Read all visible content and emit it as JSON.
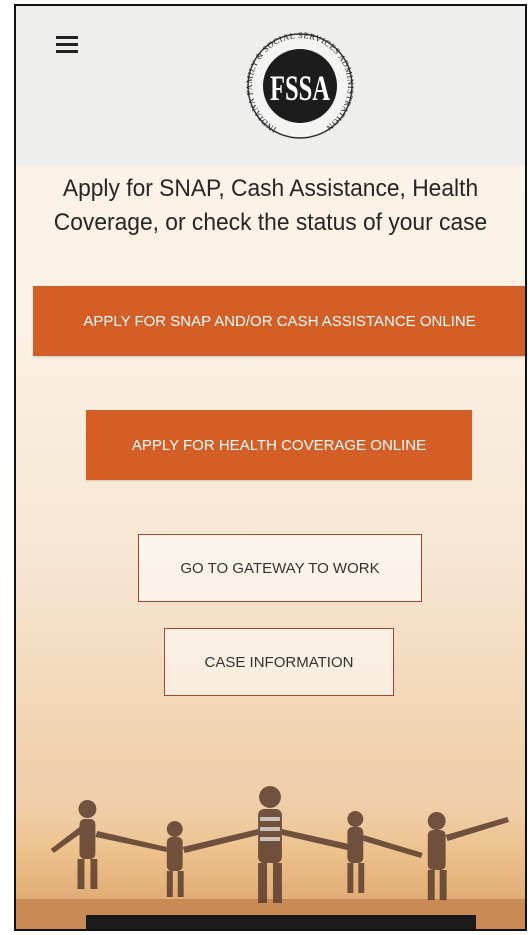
{
  "header": {
    "menu_icon": "hamburger-menu-icon",
    "logo": {
      "ring_text": "INDIANA FAMILY & SOCIAL SERVICES ADMINISTRATION",
      "monogram": "FSSA"
    }
  },
  "main": {
    "heading_line1": "Apply for SNAP, Cash Assistance, Health",
    "heading_line2": "Coverage, or check the status of your case",
    "buttons": {
      "snap_cash": "APPLY FOR SNAP AND/OR CASH ASSISTANCE ONLINE",
      "health": "APPLY FOR HEALTH COVERAGE ONLINE",
      "gateway": "GO TO GATEWAY TO WORK",
      "case_info": "CASE INFORMATION"
    }
  },
  "colors": {
    "accent": "#d35f27",
    "outline_border": "#9b4a2d",
    "header_bg": "#eeeeec"
  }
}
